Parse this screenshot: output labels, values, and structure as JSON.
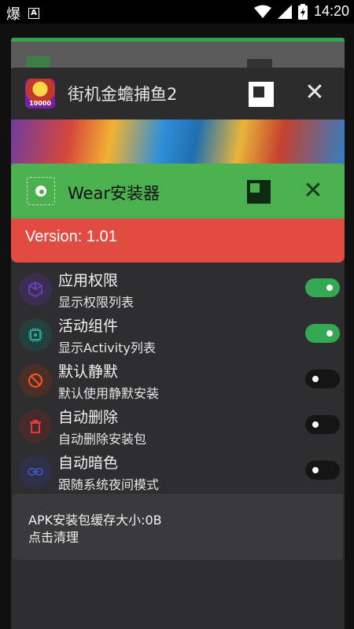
{
  "statusbar": {
    "left_glyph": "爆",
    "badge": "A",
    "time": "14:20"
  },
  "game_card": {
    "title": "街机金蟾捕鱼2",
    "icon_label": "10000"
  },
  "wear_card": {
    "title": "Wear安装器",
    "version": "Version: 1.01"
  },
  "settings": [
    {
      "title": "应用权限",
      "subtitle": "显示权限列表",
      "on": true,
      "icon": "cube-icon",
      "icon_color": "#6a3cc0",
      "bg": "#3a2f4f"
    },
    {
      "title": "活动组件",
      "subtitle": "显示Activity列表",
      "on": true,
      "icon": "chip-icon",
      "icon_color": "#26a69a",
      "bg": "#23403d"
    },
    {
      "title": "默认静默",
      "subtitle": "默认使用静默安装",
      "on": false,
      "icon": "block-icon",
      "icon_color": "#f4511e",
      "bg": "#4a2e27"
    },
    {
      "title": "自动删除",
      "subtitle": "自动删除安装包",
      "on": false,
      "icon": "trash-icon",
      "icon_color": "#e53935",
      "bg": "#472a2a"
    },
    {
      "title": "自动暗色",
      "subtitle": "跟随系统夜间模式",
      "on": false,
      "icon": "link-icon",
      "icon_color": "#3f51b5",
      "bg": "#2d3048"
    }
  ],
  "cache": {
    "size_text": "APK安装包缓存大小:0B",
    "action_text": "点击清理"
  }
}
